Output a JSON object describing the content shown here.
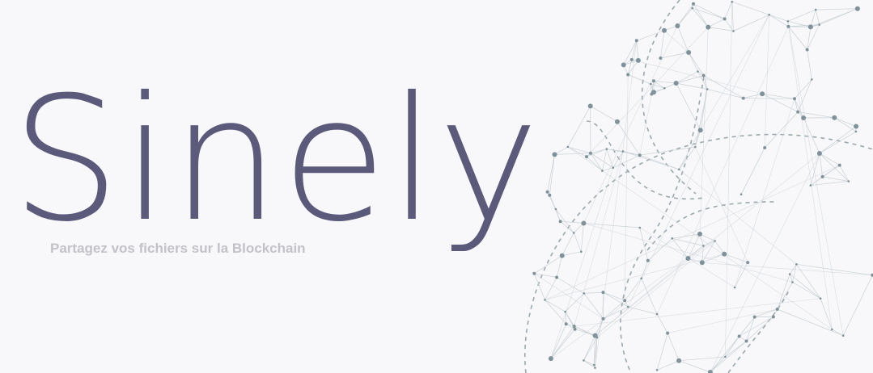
{
  "hero": {
    "title": "Sinely",
    "tagline": "Partagez vos fichiers sur la Blockchain"
  },
  "colors": {
    "background": "#f8f8fa",
    "title": "#5b5a7b",
    "tagline": "#c2c2c8",
    "network_node": "#7f9299",
    "network_line": "#c9d1d6"
  },
  "icons": {
    "network": "network-globe-illustration"
  }
}
